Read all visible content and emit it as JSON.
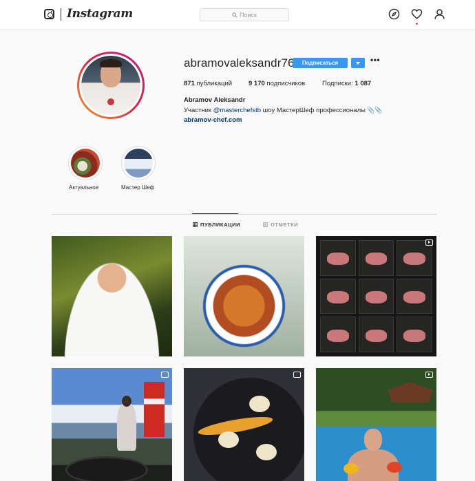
{
  "header": {
    "logo_text": "Instagram",
    "search_placeholder": "Поиск",
    "nav_icons": [
      "explore-compass-icon",
      "heart-icon",
      "profile-icon"
    ]
  },
  "profile": {
    "username": "abramovaleksandr76",
    "follow_label": "Подписаться",
    "more_label": "•••",
    "posts_count": "871",
    "posts_label": "публикаций",
    "followers_count": "9 170",
    "followers_label": "подписчиков",
    "following_label": "Подписки:",
    "following_count": "1 087",
    "full_name": "Abramov Aleksandr",
    "bio_prefix": "Участник ",
    "bio_mention": "@masterchefstb",
    "bio_suffix": " шоу МастерШеф профессионалы",
    "bio_emoji": "📎📎",
    "website": "abramov-chef.com"
  },
  "highlights": [
    {
      "label": "Актуальное"
    },
    {
      "label": "Мастер Шеф"
    }
  ],
  "tabs": [
    {
      "label": "ПУБЛИКАЦИИ",
      "active": true
    },
    {
      "label": "ОТМЕТКИ",
      "active": false
    }
  ],
  "posts": [
    {
      "name": "chef-portrait",
      "badge": "none"
    },
    {
      "name": "vegetable-stew-plate",
      "badge": "none"
    },
    {
      "name": "meat-cuts-grid",
      "badge": "video"
    },
    {
      "name": "lighthouse-grill",
      "badge": "multiple"
    },
    {
      "name": "scallops-plate",
      "badge": "multiple"
    },
    {
      "name": "pool-fruit",
      "badge": "video"
    }
  ],
  "colors": {
    "accent": "#3897f0",
    "link": "#003569",
    "notification": "#ed4956"
  }
}
